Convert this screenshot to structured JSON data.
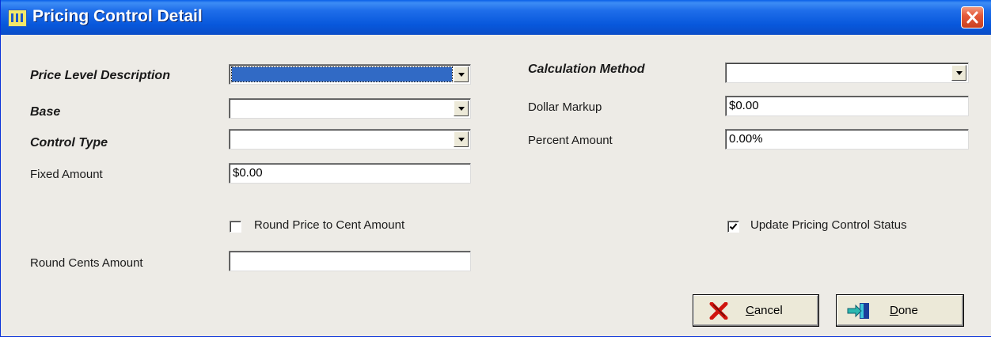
{
  "window": {
    "title": "Pricing Control Detail"
  },
  "left": {
    "price_level_label": "Price Level Description",
    "price_level_value": "",
    "base_label": "Base",
    "base_value": "",
    "control_type_label": "Control Type",
    "control_type_value": "",
    "fixed_amount_label": "Fixed Amount",
    "fixed_amount_value": "$0.00",
    "round_price_label": "Round Price to Cent Amount",
    "round_price_checked": false,
    "round_cents_label": "Round Cents Amount",
    "round_cents_value": ""
  },
  "right": {
    "calc_method_label": "Calculation Method",
    "calc_method_value": "",
    "dollar_markup_label": "Dollar Markup",
    "dollar_markup_value": "$0.00",
    "percent_amount_label": "Percent Amount",
    "percent_amount_value": "0.00%",
    "update_status_label": "Update Pricing Control Status",
    "update_status_checked": true
  },
  "buttons": {
    "cancel_mnemonic": "C",
    "cancel_rest": "ancel",
    "done_mnemonic": "D",
    "done_rest": "one"
  },
  "icons": {
    "app": "app-window-icon",
    "close": "close-icon",
    "cancel": "red-x-icon",
    "done": "exit-door-icon"
  }
}
